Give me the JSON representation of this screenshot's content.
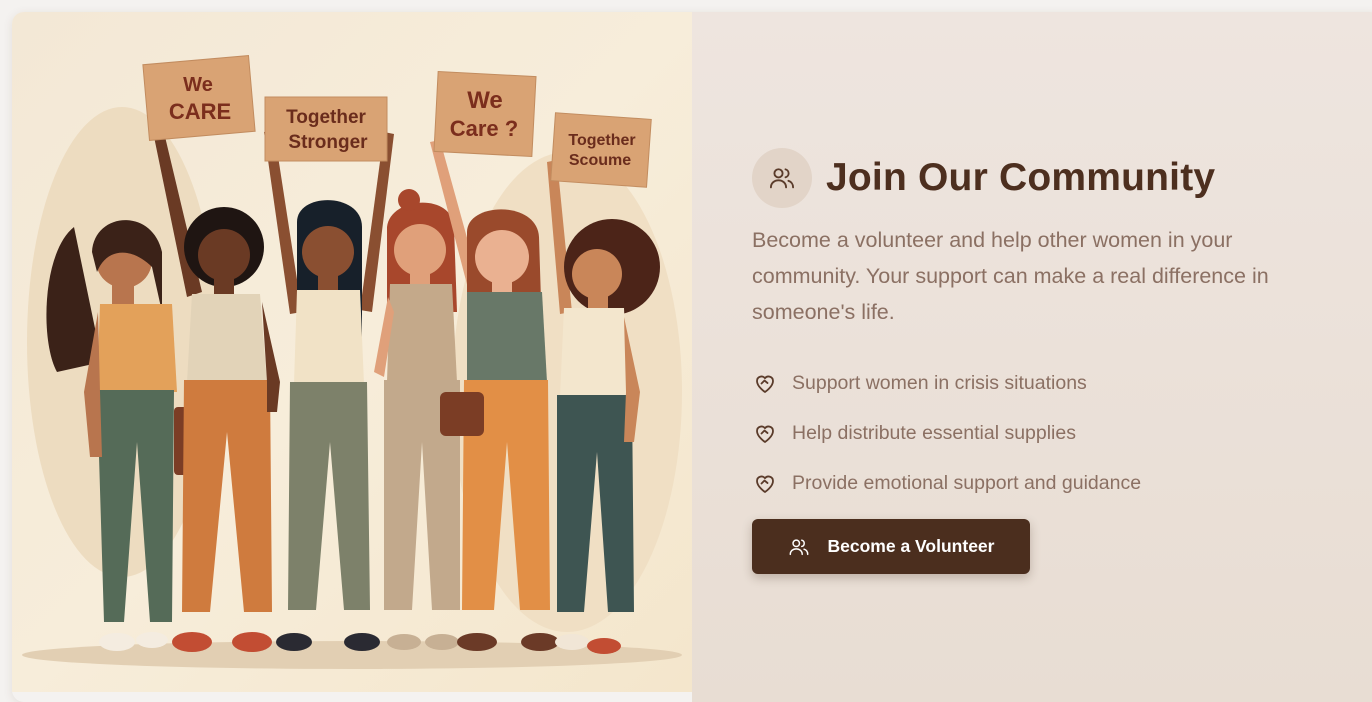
{
  "illustration": {
    "signs": [
      "We",
      "CARE",
      "Together",
      "Stronger",
      "We",
      "Care ?",
      "Together",
      "Scoume"
    ]
  },
  "join": {
    "icon": "users-icon",
    "title": "Join Our Community",
    "description": "Become a volunteer and help other women in your community. Your support can make a real difference in someone's life.",
    "bullets": [
      {
        "icon": "heart-handshake-icon",
        "text": "Support women in crisis situations"
      },
      {
        "icon": "heart-handshake-icon",
        "text": "Help distribute essential supplies"
      },
      {
        "icon": "heart-handshake-icon",
        "text": "Provide emotional support and guidance"
      }
    ],
    "cta": {
      "icon": "users-icon",
      "label": "Become a Volunteer"
    }
  },
  "colors": {
    "title": "#4d2f1f",
    "body_text": "#8b7063",
    "button_bg": "#4b2e1e",
    "panel_bg": "#eee5df",
    "icon_circle": "#e2d4c8"
  }
}
